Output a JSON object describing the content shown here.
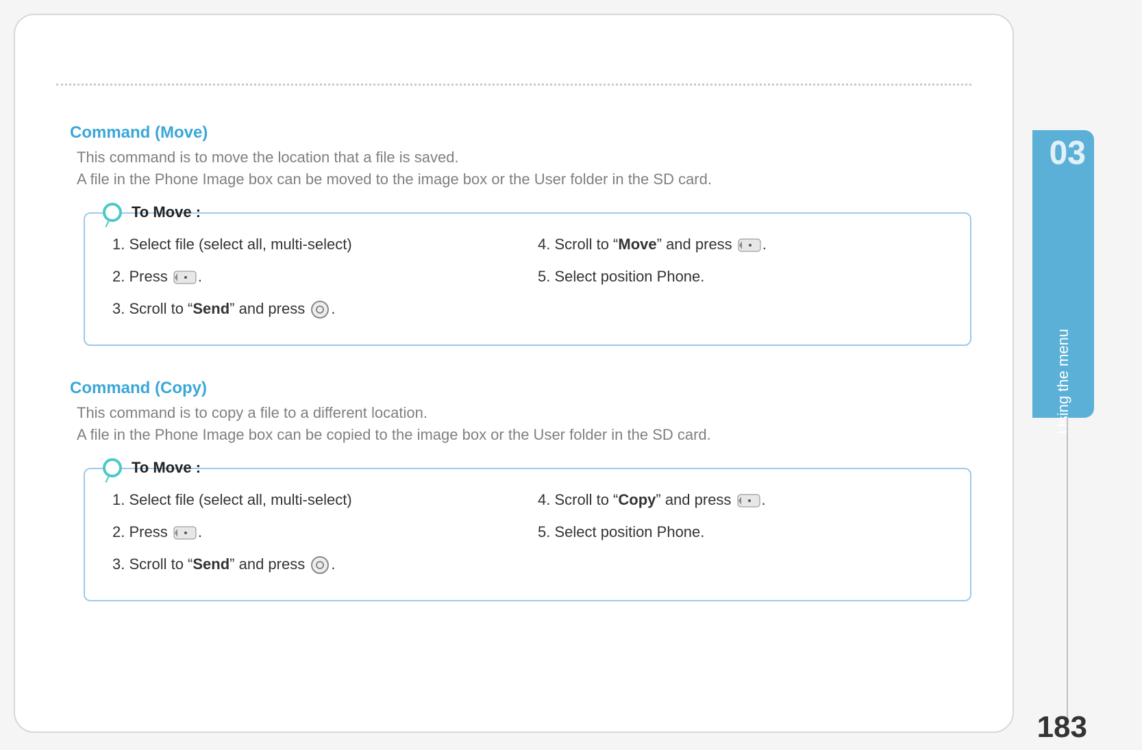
{
  "chapter_number": "03",
  "side_label": "Using the menu",
  "page_number": "183",
  "sections": [
    {
      "title": "Command (Move)",
      "desc_line1": "This command is to move the location that a file is saved.",
      "desc_line2": "A file in the Phone Image box can be moved to the image box or the User folder in the SD card.",
      "panel_label": "To Move :",
      "steps_left": {
        "s1": "1.  Select file (select all, multi-select)",
        "s2_a": "2.  Press ",
        "s2_b": ".",
        "s3_a": "3.  Scroll to “",
        "s3_bold": "Send",
        "s3_b": "” and press ",
        "s3_c": "."
      },
      "steps_right": {
        "s4_a": "4.  Scroll to “",
        "s4_bold": "Move",
        "s4_b": "” and press ",
        "s4_c": ".",
        "s5": "5.  Select position Phone."
      }
    },
    {
      "title": "Command (Copy)",
      "desc_line1": "This command is to copy a file to a different location.",
      "desc_line2": "A file in the Phone Image box can be copied to the image box or the User folder in the SD card.",
      "panel_label": "To Move :",
      "steps_left": {
        "s1": "1.  Select file (select all, multi-select)",
        "s2_a": "2.  Press ",
        "s2_b": ".",
        "s3_a": "3.  Scroll to “",
        "s3_bold": "Send",
        "s3_b": "” and press ",
        "s3_c": "."
      },
      "steps_right": {
        "s4_a": "4.  Scroll to “",
        "s4_bold": "Copy",
        "s4_b": "” and press ",
        "s4_c": ".",
        "s5": "5.  Select position Phone."
      }
    }
  ]
}
